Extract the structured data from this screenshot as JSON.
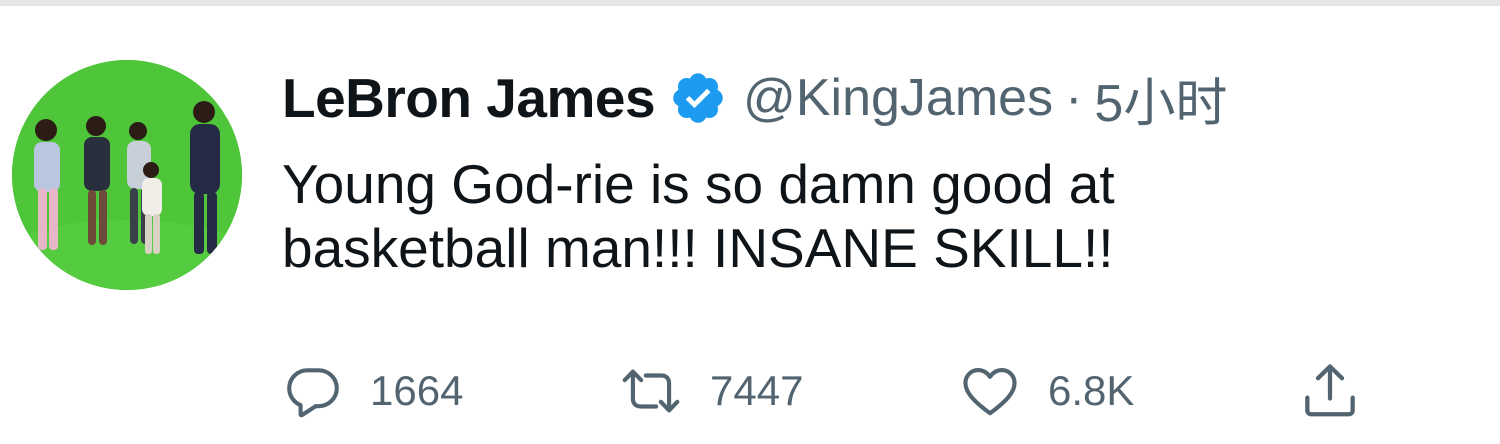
{
  "tweet": {
    "author_name": "LeBron James",
    "handle": "@KingJames",
    "separator": "·",
    "time": "5小时",
    "text_line1": "Young God-rie is so damn good at",
    "text_line2": "basketball man!!! INSANE SKILL!!",
    "verified": true
  },
  "actions": {
    "reply_count": "1664",
    "retweet_count": "7447",
    "like_count": "6.8K"
  },
  "colors": {
    "text_primary": "#0f1419",
    "text_secondary": "#536471",
    "verified_blue": "#1d9bf0",
    "avatar_green": "#4fc53a"
  },
  "icons": {
    "reply": "reply-icon",
    "retweet": "retweet-icon",
    "like": "like-icon",
    "share": "share-icon",
    "verified": "verified-badge-icon"
  }
}
